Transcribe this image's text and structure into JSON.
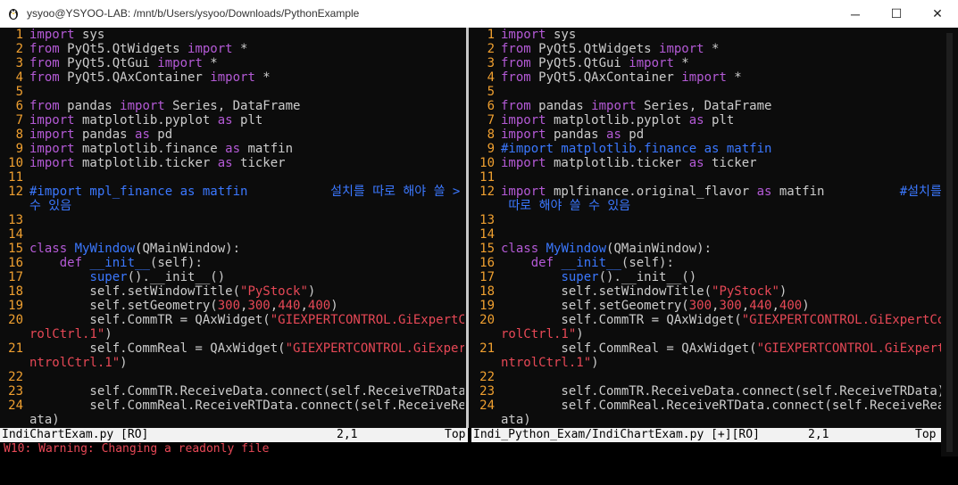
{
  "window": {
    "title": "ysyoo@YSYOO-LAB: /mnt/b/Users/ysyoo/Downloads/PythonExample",
    "minimize": "─",
    "maximize": "☐",
    "close": "✕"
  },
  "left": {
    "lines": [
      {
        "n": "1",
        "c": "<span class='kw'>import</span> sys"
      },
      {
        "n": "2",
        "c": "<span class='kw'>from</span> PyQt5.QtWidgets <span class='kw'>import</span> *"
      },
      {
        "n": "3",
        "c": "<span class='kw'>from</span> PyQt5.QtGui <span class='kw'>import</span> *"
      },
      {
        "n": "4",
        "c": "<span class='kw'>from</span> PyQt5.QAxContainer <span class='kw'>import</span> *"
      },
      {
        "n": "5",
        "c": ""
      },
      {
        "n": "6",
        "c": "<span class='kw'>from</span> pandas <span class='kw'>import</span> Series, DataFrame"
      },
      {
        "n": "7",
        "c": "<span class='kw'>import</span> matplotlib.pyplot <span class='kw'>as</span> plt"
      },
      {
        "n": "8",
        "c": "<span class='kw'>import</span> pandas <span class='kw'>as</span> pd"
      },
      {
        "n": "9",
        "c": "<span class='kw'>import</span> matplotlib.finance <span class='kw'>as</span> matfin"
      },
      {
        "n": "10",
        "c": "<span class='kw'>import</span> matplotlib.ticker <span class='kw'>as</span> ticker"
      },
      {
        "n": "11",
        "c": ""
      },
      {
        "n": "12",
        "c": "<span class='cm'>#import mpl_finance as matfin           설치를 따로 해야 쓸 &gt;</span>"
      },
      {
        "n": "",
        "c": "<span class='cm'>수 있음</span>"
      },
      {
        "n": "13",
        "c": ""
      },
      {
        "n": "14",
        "c": ""
      },
      {
        "n": "15",
        "c": "<span class='kw'>class</span> <span class='fn'>MyWindow</span>(QMainWindow):"
      },
      {
        "n": "16",
        "c": "    <span class='kw'>def</span> <span class='fn'>__init__</span>(self):"
      },
      {
        "n": "17",
        "c": "        <span class='fn'>super</span>().__init__()"
      },
      {
        "n": "18",
        "c": "        self.setWindowTitle(<span class='str'>\"PyStock\"</span>)"
      },
      {
        "n": "19",
        "c": "        self.setGeometry(<span class='num'>300</span>,<span class='num'>300</span>,<span class='num'>440</span>,<span class='num'>400</span>)"
      },
      {
        "n": "20",
        "c": "        self.CommTR = QAxWidget(<span class='str'>\"GIEXPERTCONTROL.GiExpertCont</span>"
      },
      {
        "n": "",
        "c": "<span class='str'>rolCtrl.1\"</span>)"
      },
      {
        "n": "21",
        "c": "        self.CommReal = QAxWidget(<span class='str'>\"GIEXPERTCONTROL.GiExpertCo</span>"
      },
      {
        "n": "",
        "c": "<span class='str'>ntrolCtrl.1\"</span>)"
      },
      {
        "n": "22",
        "c": ""
      },
      {
        "n": "23",
        "c": "        self.CommTR.ReceiveData.connect(self.ReceiveTRData)"
      },
      {
        "n": "24",
        "c": "        self.CommReal.ReceiveRTData.connect(self.ReceiveRealID"
      },
      {
        "n": "",
        "c": "ata)"
      }
    ],
    "status_file": "IndiChartExam.py [RO]",
    "status_pos": "2,1",
    "status_scroll": "Top"
  },
  "right": {
    "lines": [
      {
        "n": "1",
        "c": "<span class='kw'>import</span> sys"
      },
      {
        "n": "2",
        "c": "<span class='kw'>from</span> PyQt5.QtWidgets <span class='kw'>import</span> *"
      },
      {
        "n": "3",
        "c": "<span class='kw'>from</span> PyQt5.QtGui <span class='kw'>import</span> *"
      },
      {
        "n": "4",
        "c": "<span class='kw'>from</span> PyQt5.QAxContainer <span class='kw'>import</span> *"
      },
      {
        "n": "5",
        "c": ""
      },
      {
        "n": "6",
        "c": "<span class='kw'>from</span> pandas <span class='kw'>import</span> Series, DataFrame"
      },
      {
        "n": "7",
        "c": "<span class='kw'>import</span> matplotlib.pyplot <span class='kw'>as</span> plt"
      },
      {
        "n": "8",
        "c": "<span class='kw'>import</span> pandas <span class='kw'>as</span> pd"
      },
      {
        "n": "9",
        "c": "<span class='cm'>#import matplotlib.finance as matfin</span>"
      },
      {
        "n": "10",
        "c": "<span class='kw'>import</span> matplotlib.ticker <span class='kw'>as</span> ticker"
      },
      {
        "n": "11",
        "c": ""
      },
      {
        "n": "12",
        "c": "<span class='kw'>import</span> mplfinance.original_flavor <span class='kw'>as</span> matfin          <span class='cm'>#설치를</span>"
      },
      {
        "n": "",
        "c": "<span class='cm'> 따로 해야 쓸 수 있음</span>"
      },
      {
        "n": "13",
        "c": ""
      },
      {
        "n": "14",
        "c": ""
      },
      {
        "n": "15",
        "c": "<span class='kw'>class</span> <span class='fn'>MyWindow</span>(QMainWindow):"
      },
      {
        "n": "16",
        "c": "    <span class='kw'>def</span> <span class='fn'>__init__</span>(self):"
      },
      {
        "n": "17",
        "c": "        <span class='fn'>super</span>().__init__()"
      },
      {
        "n": "18",
        "c": "        self.setWindowTitle(<span class='str'>\"PyStock\"</span>)"
      },
      {
        "n": "19",
        "c": "        self.setGeometry(<span class='num'>300</span>,<span class='num'>300</span>,<span class='num'>440</span>,<span class='num'>400</span>)"
      },
      {
        "n": "20",
        "c": "        self.CommTR = QAxWidget(<span class='str'>\"GIEXPERTCONTROL.GiExpertCont</span>"
      },
      {
        "n": "",
        "c": "<span class='str'>rolCtrl.1\"</span>)"
      },
      {
        "n": "21",
        "c": "        self.CommReal = QAxWidget(<span class='str'>\"GIEXPERTCONTROL.GiExpertCo</span>"
      },
      {
        "n": "",
        "c": "<span class='str'>ntrolCtrl.1\"</span>)"
      },
      {
        "n": "22",
        "c": ""
      },
      {
        "n": "23",
        "c": "        self.CommTR.ReceiveData.connect(self.ReceiveTRData)"
      },
      {
        "n": "24",
        "c": "        self.CommReal.ReceiveRTData.connect(self.ReceiveRealID"
      },
      {
        "n": "",
        "c": "ata)"
      }
    ],
    "status_file": "Indi_Python_Exam/IndiChartExam.py [+][RO]",
    "status_pos": "2,1",
    "status_scroll": "Top"
  },
  "command_line": "W10: Warning: Changing a readonly file",
  "colors": {
    "keyword": "#b45ad6",
    "function": "#3b78ff",
    "string": "#e74856",
    "line_number": "#f0a030",
    "comment": "#3b78ff"
  }
}
